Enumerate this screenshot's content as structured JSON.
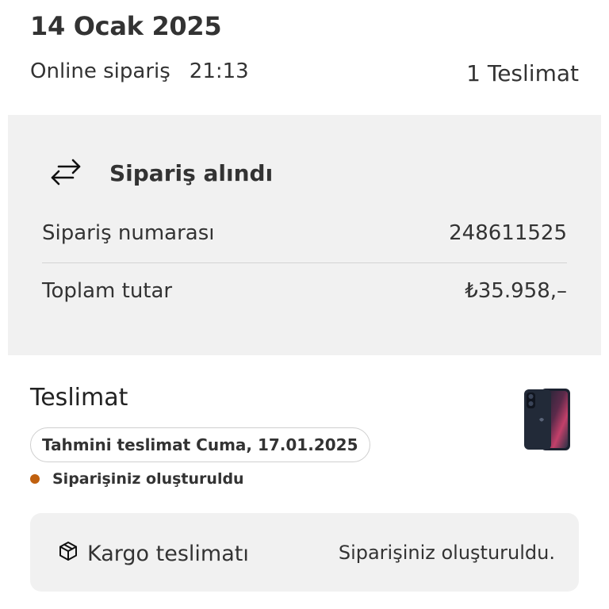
{
  "header": {
    "date": "14 Ocak 2025",
    "order_type": "Online sipariş",
    "time": "21:13",
    "deliveries": "1 Teslimat"
  },
  "order_card": {
    "status_title": "Sipariş alındı",
    "status_icon": "arrows-exchange-icon",
    "order_number_label": "Sipariş numarası",
    "order_number_value": "248611525",
    "total_label": "Toplam tutar",
    "total_value": "₺35.958,–"
  },
  "delivery": {
    "title": "Teslimat",
    "product_image": "iphone-product-image",
    "estimate": "Tahmini teslimat Cuma, 17.01.2025",
    "status": "Siparişiniz oluşturuldu",
    "status_color": "#c0600e",
    "shipping_label": "Kargo teslimatı",
    "shipping_icon": "package-icon",
    "shipping_status": "Siparişiniz oluşturuldu."
  }
}
